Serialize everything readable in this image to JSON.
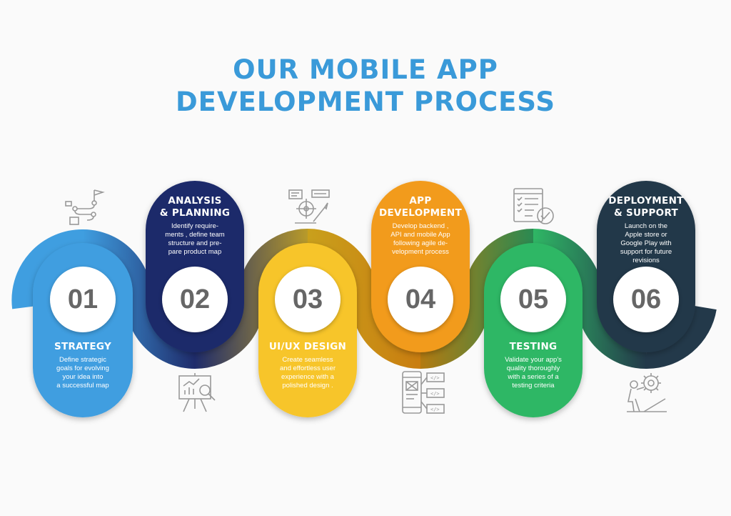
{
  "title": {
    "line1": "OUR MOBILE APP",
    "line2": "DEVELOPMENT PROCESS"
  },
  "colors": {
    "accent": "#3a9ad9",
    "strategy": "#3f9ee0",
    "analysis": "#1f2c6b",
    "design": "#f7c52c",
    "development": "#f29b1d",
    "testing": "#2fb765",
    "deployment": "#23394a"
  },
  "steps": [
    {
      "number": "01",
      "heading": "STRATEGY",
      "description": "Define strategic\ngoals for evolving\nyour idea into\na successful map",
      "icon": "roadmap-icon"
    },
    {
      "number": "02",
      "heading": "ANALYSIS\n& PLANNING",
      "description": "Identify require-\nments , define team\nstructure and pre-\npare product map",
      "icon": "analytics-board-icon"
    },
    {
      "number": "03",
      "heading": "UI/UX DESIGN",
      "description": "Create seamless\nand effortless user\nexperience with a\npolished design .",
      "icon": "design-tools-icon"
    },
    {
      "number": "04",
      "heading": "APP\nDEVELOPMENT",
      "description": "Develop backend ,\nAPI and mobile App\nfollowing agile de-\nvelopment process",
      "icon": "code-modules-icon"
    },
    {
      "number": "05",
      "heading": "TESTING",
      "description": "Validate your app's\nquality thoroughly\nwith a series of a\ntesting criteria",
      "icon": "checklist-icon"
    },
    {
      "number": "06",
      "heading": "DEPLOYMENT\n& SUPPORT",
      "description": "Launch on the\nApple store or\nGoogle Play with\nsupport for future\nrevisions",
      "icon": "support-gear-icon"
    }
  ]
}
